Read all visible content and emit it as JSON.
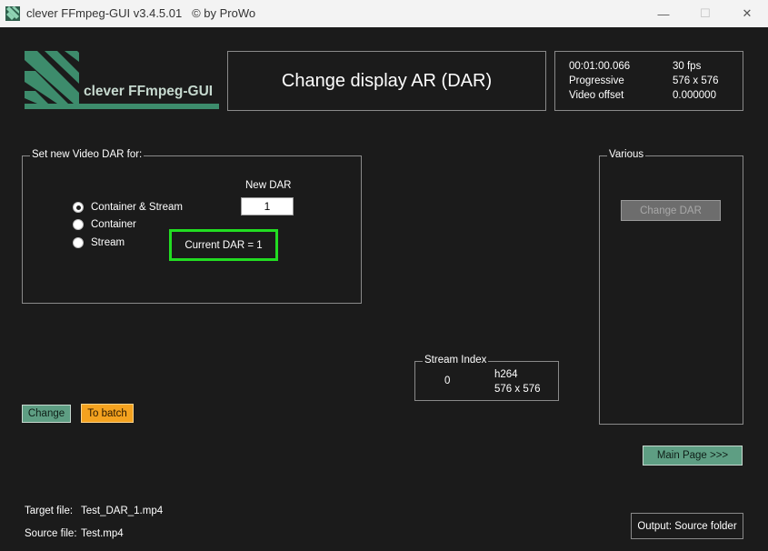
{
  "window": {
    "title": "clever FFmpeg-GUI v3.4.5.01   © by ProWo",
    "minimize_label": "—",
    "maximize_label": "☐",
    "close_label": "✕"
  },
  "logo": {
    "text": "clever FFmpeg-GUI"
  },
  "header": {
    "title": "Change display AR (DAR)"
  },
  "info": {
    "duration": "00:01:00.066",
    "fps": "30 fps",
    "scan": "Progressive",
    "resolution": "576 x 576",
    "offset_label": "Video offset",
    "offset_value": "0.000000"
  },
  "dar_group": {
    "legend": "Set new Video DAR for:",
    "options": [
      "Container & Stream",
      "Container",
      "Stream"
    ],
    "selected": "Container & Stream",
    "new_dar_label": "New DAR",
    "new_dar_value": "1",
    "current_dar": "Current DAR = 1"
  },
  "various": {
    "legend": "Various",
    "change_dar_button": "Change DAR"
  },
  "stream": {
    "legend": "Stream Index",
    "index": "0",
    "codec": "h264",
    "resolution": "576 x 576"
  },
  "buttons": {
    "change": "Change",
    "to_batch": "To batch",
    "main_page": "Main Page >>>",
    "output": "Output: Source folder"
  },
  "files": {
    "target_label": "Target file:",
    "target_value": "Test_DAR_1.mp4",
    "source_label": "Source file:",
    "source_value": "Test.mp4"
  },
  "colors": {
    "accent_green": "#5e9e83",
    "batch_orange": "#f4a21f",
    "highlight": "#22dd22",
    "background": "#1b1b1b"
  }
}
